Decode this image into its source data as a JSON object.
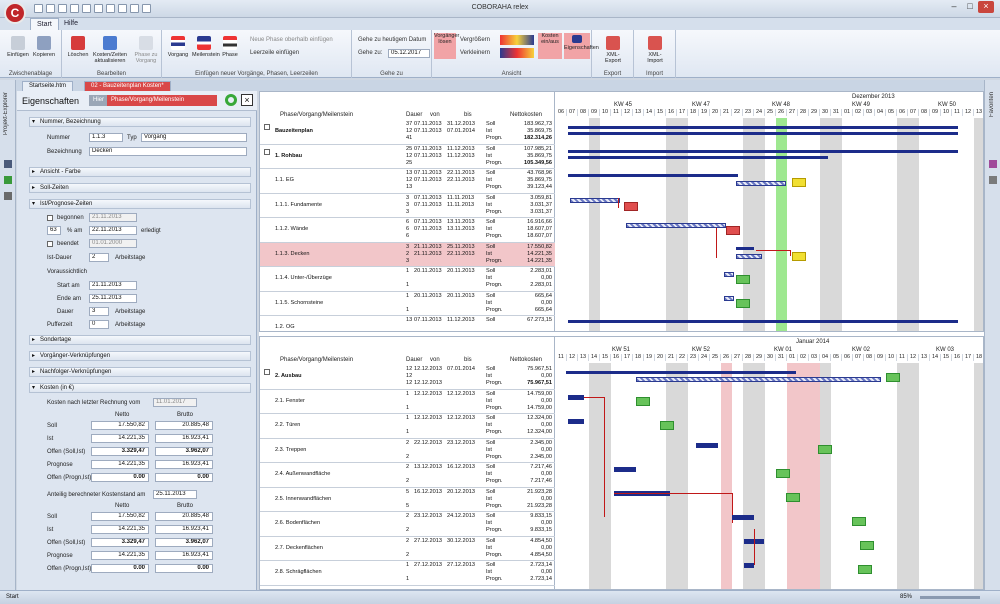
{
  "app": {
    "title": "COBORAHA relex",
    "logo_letter": "C"
  },
  "ribbon": {
    "tabs": [
      "Start",
      "Hilfe"
    ],
    "groups": [
      {
        "label": "Zwischenablage",
        "buttons": [
          "Einfügen",
          "Kopieren"
        ]
      },
      {
        "label": "Bearbeiten",
        "buttons": [
          "Löschen",
          "Kosten/Zeiten aktualisieren",
          "Phase zu Vorgang"
        ]
      },
      {
        "label": "Einfügen neuer Vorgänge, Phasen, Leerzeilen",
        "buttons": [
          "Vorgang",
          "Meilenstein",
          "Phase"
        ],
        "small": [
          "Neue Phase oberhalb einfügen",
          "Leerzeile einfügen"
        ]
      },
      {
        "label": "Gehe zu",
        "small": [
          "Gehe zu heutigem Datum",
          "Gehe zu:"
        ],
        "date_value": "05.12.2017"
      },
      {
        "label": "Ansicht",
        "buttons": [
          "Vorgänger lösen",
          "Kosten ein/aus",
          "Eigenschaften"
        ],
        "small": [
          "Vergrößern",
          "Verkleinern"
        ]
      },
      {
        "label": "Export",
        "buttons": [
          "XML-Export"
        ]
      },
      {
        "label": "Import",
        "buttons": [
          "XML-Import"
        ]
      }
    ]
  },
  "sidebar_left_label": "Projekt-Explorer",
  "sidebar_right_label": "Favoriten",
  "doc_tabs": [
    "Startseite.htm",
    "02 - Bauzeitenplan Kosten*"
  ],
  "properties": {
    "title": "Eigenschaften",
    "mode_label": "Hier",
    "mode_value": "Phase/Vorgang/Meilenstein",
    "sections": {
      "nummer": "Nummer, Bezeichnung",
      "ansicht": "Ansicht - Farbe",
      "soll": "Soll-Zeiten",
      "ist": "Ist/Prognose-Zeiten",
      "sonder": "Sondertage",
      "vorg": "Vorgänger-Verknüpfungen",
      "nach": "Nachfolger-Verknüpfungen",
      "kosten": "Kosten (in €)"
    },
    "nummer_label": "Nummer",
    "nummer_value": "1.1.3",
    "typ_label": "Typ",
    "typ_value": "Vorgang",
    "bez_label": "Bezeichnung",
    "bez_value": "Decken",
    "begonnen_label": "begonnen",
    "begonnen_value": "21.11.2013",
    "pct_value": "63",
    "pct_label": "% am",
    "pct_date": "22.11.2013",
    "erledigt_label": "erledigt",
    "beendet_label": "beendet",
    "beendet_value": "01.01.2000",
    "istdauer_label": "Ist-Dauer",
    "istdauer_value": "2",
    "arbeitstage": "Arbeitstage",
    "voraus_label": "Voraussichtlich",
    "start_label": "Start am",
    "start_value": "21.11.2013",
    "ende_label": "Ende am",
    "ende_value": "25.11.2013",
    "dauer_label": "Dauer",
    "dauer_value": "3",
    "puffer_label": "Pufferzeit",
    "puffer_value": "0",
    "kosten_stand_label": "Kosten nach letzter Rechnung vom",
    "kosten_stand_date": "11.01.2017",
    "netto": "Netto",
    "brutto": "Brutto",
    "table1": [
      {
        "label": "Soll",
        "netto": "17.550,82",
        "brutto": "20.885,48",
        "bold": false
      },
      {
        "label": "Ist",
        "netto": "14.221,35",
        "brutto": "16.923,41",
        "bold": false
      },
      {
        "label": "Offen (Soll,Ist)",
        "netto": "3.329,47",
        "brutto": "3.962,07",
        "bold": true
      },
      {
        "label": "Prognose",
        "netto": "14.221,35",
        "brutto": "16.923,41",
        "bold": false
      },
      {
        "label": "Offen (Progn,Ist)",
        "netto": "0.00",
        "brutto": "0.00",
        "bold": true
      }
    ],
    "anteil_label": "Anteilig berechneter Kostenstand am",
    "anteil_date": "25.11.2013",
    "table2": [
      {
        "label": "Soll",
        "netto": "17.550,82",
        "brutto": "20.885,48",
        "bold": false
      },
      {
        "label": "Ist",
        "netto": "14.221,35",
        "brutto": "16.923,41",
        "bold": false
      },
      {
        "label": "Offen (Soll,Ist)",
        "netto": "3.329,47",
        "brutto": "3.962,07",
        "bold": true
      },
      {
        "label": "Prognose",
        "netto": "14.221,35",
        "brutto": "16.923,41",
        "bold": false
      },
      {
        "label": "Offen (Progn,Ist)",
        "netto": "0.00",
        "brutto": "0.00",
        "bold": true
      }
    ]
  },
  "gantt": {
    "cols": {
      "name": "Phase/Vorgang/Meilenstein",
      "dauer": "Dauer",
      "von": "von",
      "bis": "bis",
      "kosten": "Nettokosten"
    },
    "top": {
      "month": "Dezember 2013",
      "weeks": [
        "KW 45",
        "KW 47",
        "KW 48",
        "KW 49",
        "KW 50"
      ],
      "days": [
        "06",
        "07",
        "08",
        "09",
        "10",
        "11",
        "12",
        "13",
        "14",
        "15",
        "16",
        "17",
        "18",
        "19",
        "20",
        "21",
        "22",
        "23",
        "24",
        "25",
        "26",
        "27",
        "28",
        "29",
        "30",
        "31",
        "01",
        "02",
        "03",
        "04",
        "05",
        "06",
        "07",
        "08",
        "09",
        "10",
        "11",
        "12",
        "13"
      ],
      "rows": [
        {
          "name": "Bauzeitenplan",
          "bold": true,
          "dauer": [
            "37",
            "12",
            "41"
          ],
          "von": [
            "07.11.2013",
            "07.11.2013",
            ""
          ],
          "bis": [
            "31.12.2013",
            "07.01.2014",
            ""
          ],
          "typ": [
            "Soll",
            "Ist",
            "Progn."
          ],
          "val": [
            "183.962,73",
            "35.869,75",
            "182.314,26"
          ]
        },
        {
          "name": "1. Rohbau",
          "bold": true,
          "dauer": [
            "25",
            "12",
            "25"
          ],
          "von": [
            "07.11.2013",
            "07.11.2013",
            ""
          ],
          "bis": [
            "11.12.2013",
            "11.12.2013",
            ""
          ],
          "typ": [
            "Soll",
            "Ist",
            "Progn."
          ],
          "val": [
            "107.985,21",
            "35.869,75",
            "105.349,56"
          ]
        },
        {
          "name": "1.1. EG",
          "bold": false,
          "dauer": [
            "13",
            "12",
            "13"
          ],
          "von": [
            "07.11.2013",
            "07.11.2013",
            ""
          ],
          "bis": [
            "22.11.2013",
            "22.11.2013",
            ""
          ],
          "typ": [
            "Soll",
            "Ist",
            "Progn."
          ],
          "val": [
            "43.768,96",
            "35.869,75",
            "39.123,44"
          ]
        },
        {
          "name": "1.1.1. Fundamente",
          "bold": false,
          "dauer": [
            "3",
            "3",
            "3"
          ],
          "von": [
            "07.11.2013",
            "07.11.2013",
            ""
          ],
          "bis": [
            "11.11.2013",
            "11.11.2013",
            ""
          ],
          "typ": [
            "Soll",
            "Ist",
            "Progn."
          ],
          "val": [
            "3.059,81",
            "3.031,37",
            "3.031,37"
          ]
        },
        {
          "name": "1.1.2. Wände",
          "bold": false,
          "dauer": [
            "6",
            "6",
            "6"
          ],
          "von": [
            "07.11.2013",
            "07.11.2013",
            ""
          ],
          "bis": [
            "13.11.2013",
            "13.11.2013",
            ""
          ],
          "typ": [
            "Soll",
            "Ist",
            "Progn."
          ],
          "val": [
            "16.916,66",
            "18.607,07",
            "18.607,07"
          ]
        },
        {
          "name": "1.1.3. Decken",
          "bold": false,
          "selected": true,
          "dauer": [
            "3",
            "2",
            "3"
          ],
          "von": [
            "21.11.2013",
            "21.11.2013",
            ""
          ],
          "bis": [
            "25.11.2013",
            "22.11.2013",
            ""
          ],
          "typ": [
            "Soll",
            "Ist",
            "Progn."
          ],
          "val": [
            "17.550,82",
            "14.221,35",
            "14.221,35"
          ]
        },
        {
          "name": "1.1.4. Unter-/Überzüge",
          "bold": false,
          "dauer": [
            "1",
            "",
            "1"
          ],
          "von": [
            "20.11.2013",
            "",
            ""
          ],
          "bis": [
            "20.11.2013",
            "",
            ""
          ],
          "typ": [
            "Soll",
            "Ist",
            "Progn."
          ],
          "val": [
            "2.283,01",
            "0,00",
            "2.283,01"
          ]
        },
        {
          "name": "1.1.5. Schornsteine",
          "bold": false,
          "dauer": [
            "1",
            "",
            "1"
          ],
          "von": [
            "20.11.2013",
            "",
            ""
          ],
          "bis": [
            "20.11.2013",
            "",
            ""
          ],
          "typ": [
            "Soll",
            "Ist",
            "Progn."
          ],
          "val": [
            "665,64",
            "0,00",
            "665,64"
          ]
        },
        {
          "name": "1.2. OG",
          "bold": false,
          "dauer": [
            "13",
            "",
            ""
          ],
          "von": [
            "07.11.2013",
            "",
            ""
          ],
          "bis": [
            "11.12.2013",
            "",
            ""
          ],
          "typ": [
            "Soll",
            "",
            ""
          ],
          "val": [
            "67.273,15",
            "",
            ""
          ]
        }
      ]
    },
    "bottom": {
      "month": "Januar 2014",
      "weeks": [
        "KW 51",
        "KW 52",
        "KW 01",
        "KW 02",
        "KW 03"
      ],
      "days": [
        "11",
        "12",
        "13",
        "14",
        "15",
        "16",
        "17",
        "18",
        "19",
        "20",
        "21",
        "22",
        "23",
        "24",
        "25",
        "26",
        "27",
        "28",
        "29",
        "30",
        "31",
        "01",
        "02",
        "03",
        "04",
        "05",
        "06",
        "07",
        "08",
        "09",
        "10",
        "11",
        "12",
        "13",
        "14",
        "15",
        "16",
        "17",
        "18"
      ],
      "rows": [
        {
          "name": "2. Ausbau",
          "bold": true,
          "dauer": [
            "12",
            "12",
            "12"
          ],
          "von": [
            "12.12.2013",
            "",
            "12.12.2013"
          ],
          "bis": [
            "07.01.2014",
            "",
            ""
          ],
          "typ": [
            "Soll",
            "Ist",
            "Progn."
          ],
          "val": [
            "75.967,51",
            "0,00",
            "75.967,51"
          ]
        },
        {
          "name": "2.1. Fenster",
          "bold": false,
          "dauer": [
            "1",
            "",
            "1"
          ],
          "von": [
            "12.12.2013",
            "",
            ""
          ],
          "bis": [
            "12.12.2013",
            "",
            ""
          ],
          "typ": [
            "Soll",
            "Ist",
            "Progn."
          ],
          "val": [
            "14.759,00",
            "0,00",
            "14.759,00"
          ]
        },
        {
          "name": "2.2. Türen",
          "bold": false,
          "dauer": [
            "1",
            "",
            "1"
          ],
          "von": [
            "12.12.2013",
            "",
            ""
          ],
          "bis": [
            "12.12.2013",
            "",
            ""
          ],
          "typ": [
            "Soll",
            "Ist",
            "Progn."
          ],
          "val": [
            "12.324,00",
            "0,00",
            "12.324,00"
          ]
        },
        {
          "name": "2.3. Treppen",
          "bold": false,
          "dauer": [
            "2",
            "",
            "2"
          ],
          "von": [
            "22.12.2013",
            "",
            ""
          ],
          "bis": [
            "23.12.2013",
            "",
            ""
          ],
          "typ": [
            "Soll",
            "Ist",
            "Progn."
          ],
          "val": [
            "2.345,00",
            "0,00",
            "2.345,00"
          ]
        },
        {
          "name": "2.4. Außenwandfläche",
          "bold": false,
          "dauer": [
            "2",
            "",
            "2"
          ],
          "von": [
            "13.12.2013",
            "",
            ""
          ],
          "bis": [
            "16.12.2013",
            "",
            ""
          ],
          "typ": [
            "Soll",
            "Ist",
            "Progn."
          ],
          "val": [
            "7.217,46",
            "0,00",
            "7.217,46"
          ]
        },
        {
          "name": "2.5. Innenwandflächen",
          "bold": false,
          "dauer": [
            "5",
            "",
            "5"
          ],
          "von": [
            "16.12.2013",
            "",
            ""
          ],
          "bis": [
            "20.12.2013",
            "",
            ""
          ],
          "typ": [
            "Soll",
            "Ist",
            "Progn."
          ],
          "val": [
            "21.923,28",
            "0,00",
            "21.923,28"
          ]
        },
        {
          "name": "2.6. Bodenflächen",
          "bold": false,
          "dauer": [
            "2",
            "",
            "2"
          ],
          "von": [
            "23.12.2013",
            "",
            ""
          ],
          "bis": [
            "24.12.2013",
            "",
            ""
          ],
          "typ": [
            "Soll",
            "Ist",
            "Progn."
          ],
          "val": [
            "9.833,15",
            "0,00",
            "9.833,15"
          ]
        },
        {
          "name": "2.7. Deckenflächen",
          "bold": false,
          "dauer": [
            "2",
            "",
            "2"
          ],
          "von": [
            "27.12.2013",
            "",
            ""
          ],
          "bis": [
            "30.12.2013",
            "",
            ""
          ],
          "typ": [
            "Soll",
            "Ist",
            "Progn."
          ],
          "val": [
            "4.854,50",
            "0,00",
            "4.854,50"
          ]
        },
        {
          "name": "2.8. Schrägflächen",
          "bold": false,
          "dauer": [
            "1",
            "",
            "1"
          ],
          "von": [
            "27.12.2013",
            "",
            ""
          ],
          "bis": [
            "27.12.2013",
            "",
            ""
          ],
          "typ": [
            "Soll",
            "Ist",
            "Progn."
          ],
          "val": [
            "2.723,14",
            "0,00",
            "2.723,14"
          ]
        }
      ]
    }
  },
  "status": {
    "left": "Start",
    "zoom": "85%"
  },
  "colors": {
    "bar": "#1c2c8a",
    "hatch": "#6977c2",
    "today": "#9ee890",
    "link": "#c01818",
    "selected_row": "#f2c6c9",
    "logo": "#c0262a"
  }
}
